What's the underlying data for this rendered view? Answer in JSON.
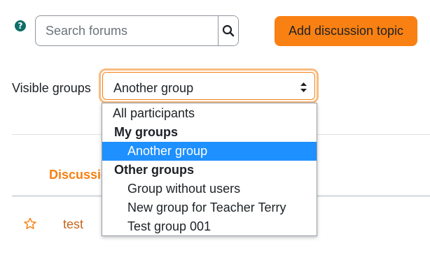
{
  "search": {
    "placeholder": "Search forums"
  },
  "add_button": {
    "label": "Add discussion topic"
  },
  "groups": {
    "label": "Visible groups",
    "selected": "Another group",
    "options": [
      {
        "label": "All participants",
        "kind": "option"
      },
      {
        "label": "My groups",
        "kind": "group"
      },
      {
        "label": "Another group",
        "kind": "option",
        "indent": true,
        "highlighted": true
      },
      {
        "label": "Other groups",
        "kind": "group"
      },
      {
        "label": "Group without users",
        "kind": "option",
        "indent": true
      },
      {
        "label": "New group for Teacher Terry",
        "kind": "option",
        "indent": true
      },
      {
        "label": "Test group 001",
        "kind": "option",
        "indent": true
      }
    ]
  },
  "table": {
    "header": "Discussio",
    "rows": [
      {
        "title": "test"
      }
    ]
  },
  "colors": {
    "accent": "#f98012",
    "highlight": "#1e90ff",
    "help": "#0f6e6a",
    "link": "#c4661f"
  }
}
